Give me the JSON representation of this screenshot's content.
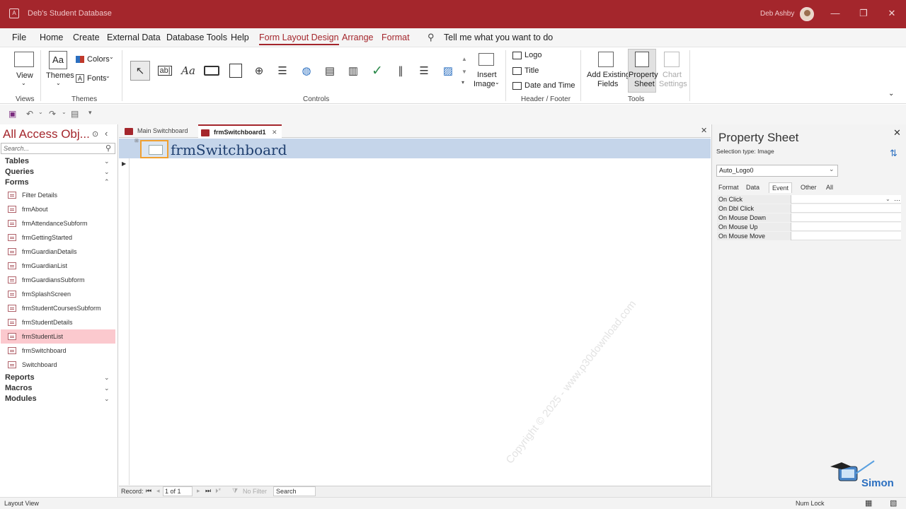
{
  "window": {
    "title": "Deb's Student Database",
    "user": "Deb Ashby"
  },
  "menu": {
    "items": [
      "File",
      "Home",
      "Create",
      "External Data",
      "Database Tools",
      "Help"
    ],
    "context": [
      "Form Layout Design",
      "Arrange",
      "Format"
    ],
    "tell": "Tell me what you want to do"
  },
  "ribbon": {
    "view": "View",
    "themes": "Themes",
    "colors": "Colors",
    "fonts": "Fonts",
    "insert_image_1": "Insert",
    "insert_image_2": "Image",
    "logo": "Logo",
    "title": "Title",
    "date_time": "Date and Time",
    "add_existing_1": "Add Existing",
    "add_existing_2": "Fields",
    "property_1": "Property",
    "property_2": "Sheet",
    "chart_1": "Chart",
    "chart_2": "Settings",
    "groups": {
      "views": "Views",
      "themes": "Themes",
      "controls": "Controls",
      "header_footer": "Header / Footer",
      "tools": "Tools"
    }
  },
  "nav": {
    "title": "All Access Obj...",
    "search_placeholder": "Search...",
    "groups": {
      "tables": "Tables",
      "queries": "Queries",
      "forms": "Forms",
      "reports": "Reports",
      "macros": "Macros",
      "modules": "Modules"
    },
    "forms": [
      "Filter Details",
      "frmAbout",
      "frmAttendanceSubform",
      "frmGettingStarted",
      "frmGuardianDetails",
      "frmGuardianList",
      "frmGuardiansSubform",
      "frmSplashScreen",
      "frmStudentCoursesSubform",
      "frmStudentDetails",
      "frmStudentList",
      "frmSwitchboard",
      "Switchboard"
    ]
  },
  "doc": {
    "tabs": [
      "Main Switchboard",
      "frmSwitchboard1"
    ],
    "form_title": "frmSwitchboard",
    "watermark": "Copyright © 2025 - www.p30download.com",
    "recnav": {
      "record": "Record:",
      "position": "1 of 1",
      "filter": "No Filter",
      "search": "Search"
    }
  },
  "property_sheet": {
    "title": "Property Sheet",
    "selection_type": "Selection type:  Image",
    "object": "Auto_Logo0",
    "tabs": [
      "Format",
      "Data",
      "Event",
      "Other",
      "All"
    ],
    "rows": [
      "On Click",
      "On Dbl Click",
      "On Mouse Down",
      "On Mouse Up",
      "On Mouse Move"
    ]
  },
  "status": {
    "left": "Layout View",
    "numlock": "Num Lock"
  },
  "colors": {
    "accent": "#a4262c",
    "selection": "#fbc9ce",
    "form_header": "#c5d5ea"
  }
}
